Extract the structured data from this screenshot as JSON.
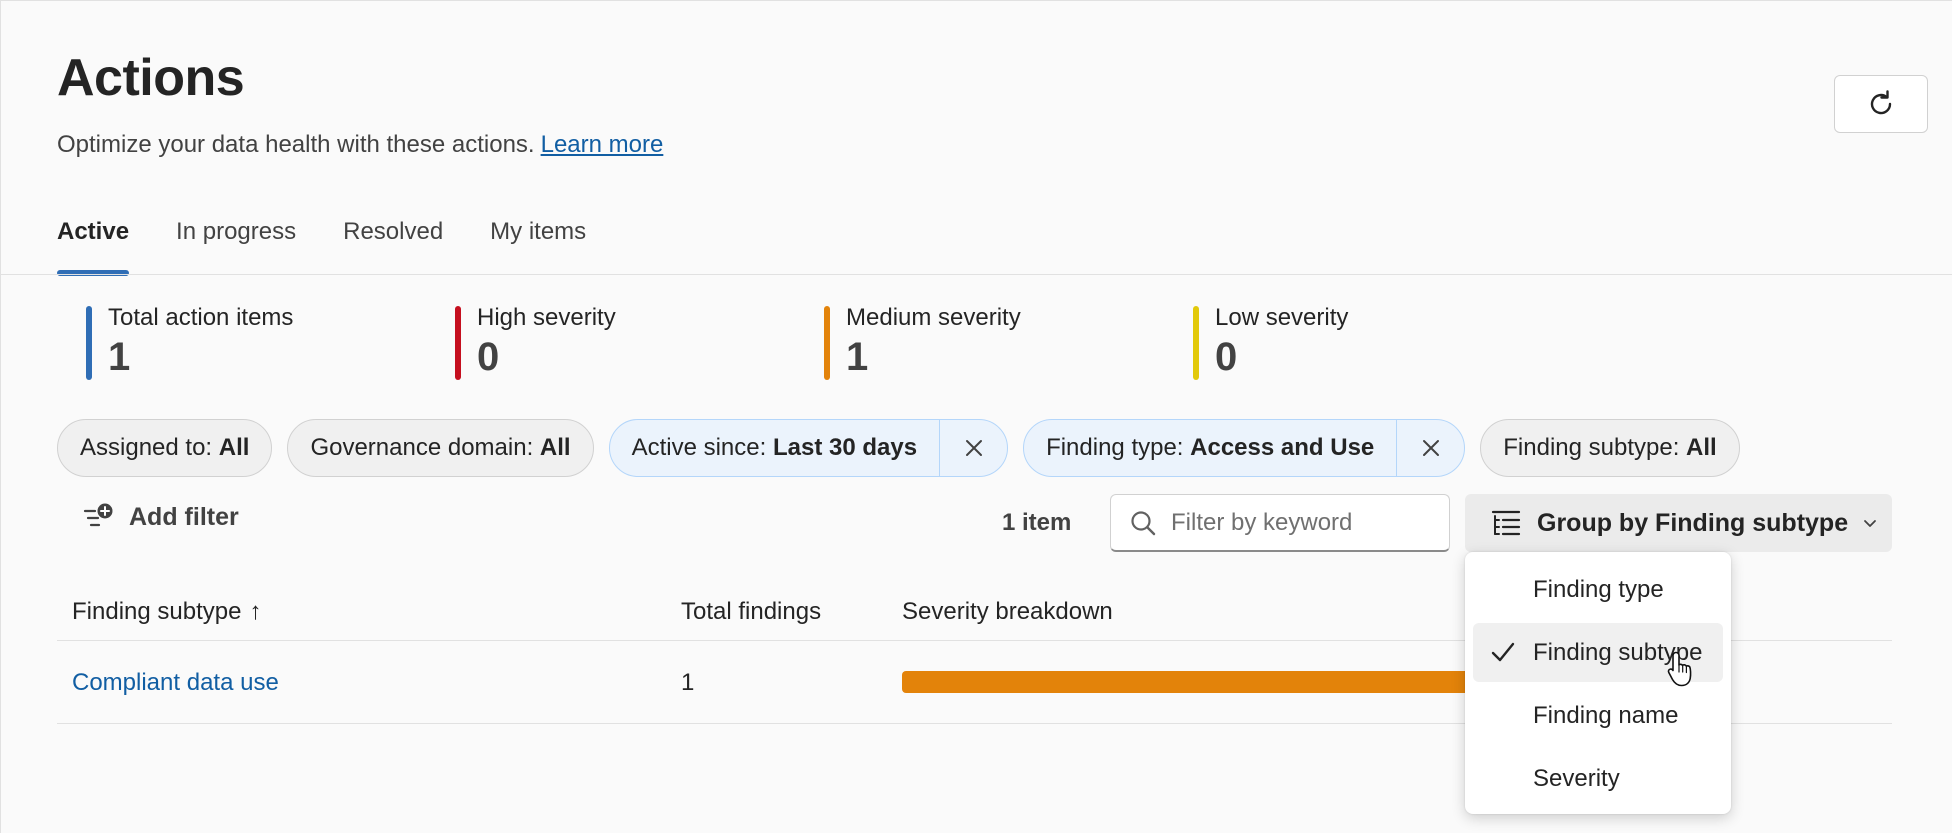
{
  "header": {
    "title": "Actions",
    "subtitle": "Optimize your data health with these actions.",
    "learn_more": "Learn more",
    "refresh_icon": "refresh-icon"
  },
  "tabs": [
    {
      "label": "Active",
      "active": true
    },
    {
      "label": "In progress",
      "active": false
    },
    {
      "label": "Resolved",
      "active": false
    },
    {
      "label": "My items",
      "active": false
    }
  ],
  "stats": [
    {
      "label": "Total action items",
      "value": "1",
      "color": "#2f6db5"
    },
    {
      "label": "High severity",
      "value": "0",
      "color": "#c50f1f"
    },
    {
      "label": "Medium severity",
      "value": "1",
      "color": "#e3830a"
    },
    {
      "label": "Low severity",
      "value": "0",
      "color": "#e2c90a"
    }
  ],
  "filters": [
    {
      "key": "Assigned to:",
      "value": "All",
      "selected": false
    },
    {
      "key": "Governance domain:",
      "value": "All",
      "selected": false
    },
    {
      "key": "Active since:",
      "value": "Last 30 days",
      "selected": true
    },
    {
      "key": "Finding type:",
      "value": "Access and Use",
      "selected": true
    },
    {
      "key": "Finding subtype:",
      "value": "All",
      "selected": false
    }
  ],
  "toolbar": {
    "add_filter": "Add filter",
    "item_count": "1 item",
    "search_placeholder": "Filter by keyword",
    "group_by": "Group by Finding subtype"
  },
  "table": {
    "columns": [
      "Finding subtype",
      "Total findings",
      "Severity breakdown"
    ],
    "sort_indicator": "↑",
    "rows": [
      {
        "finding_subtype": "Compliant data use",
        "total_findings": "1",
        "severity": {
          "medium": 1
        }
      }
    ]
  },
  "group_by_menu": {
    "options": [
      {
        "label": "Finding type",
        "checked": false
      },
      {
        "label": "Finding subtype",
        "checked": true
      },
      {
        "label": "Finding name",
        "checked": false
      },
      {
        "label": "Severity",
        "checked": false
      }
    ]
  },
  "colors": {
    "accent": "#2f6db5",
    "link": "#115ea3",
    "medium_severity": "#e3830a",
    "selected_pill_bg": "#ebf3fc"
  }
}
